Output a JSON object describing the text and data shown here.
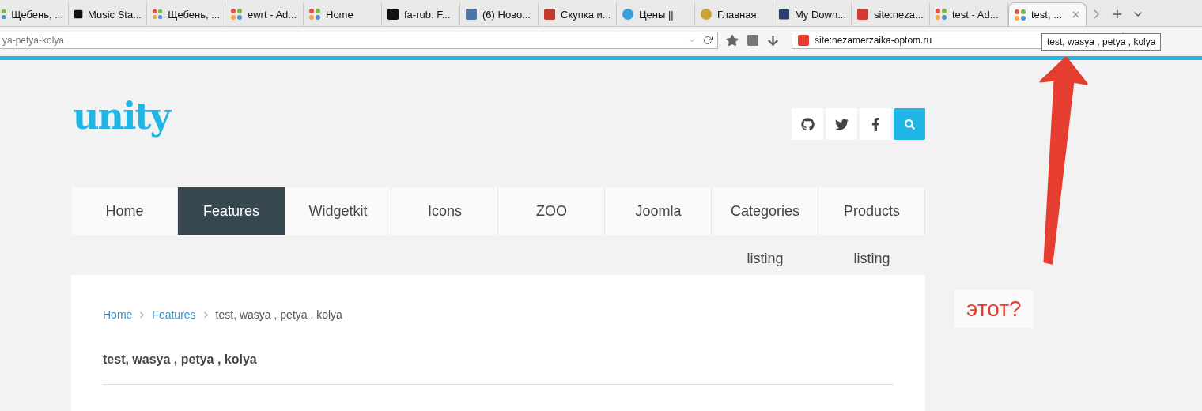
{
  "browser": {
    "tabs": [
      {
        "label": "Щебень, ...",
        "selected": false
      },
      {
        "label": "Music Sta...",
        "selected": false
      },
      {
        "label": "Щебень, ...",
        "selected": false
      },
      {
        "label": "ewrt - Ad...",
        "selected": false
      },
      {
        "label": "Home",
        "selected": false
      },
      {
        "label": "fa-rub: F...",
        "selected": false
      },
      {
        "label": "(6) Ново...",
        "selected": false
      },
      {
        "label": "Скупка и...",
        "selected": false
      },
      {
        "label": "Цены ||",
        "selected": false
      },
      {
        "label": "Главная",
        "selected": false
      },
      {
        "label": "My Down...",
        "selected": false
      },
      {
        "label": "site:neza...",
        "selected": false
      },
      {
        "label": "test - Ad...",
        "selected": false
      },
      {
        "label": "test, ...",
        "selected": true
      }
    ],
    "address_bar": {
      "value": "ya-petya-kolya"
    },
    "search_bar": {
      "value": "site:nezamerzaika-optom.ru"
    },
    "tooltip": "test, wasya , petya , kolya"
  },
  "site": {
    "logo": "unity",
    "nav": [
      {
        "label": "Home",
        "selected": false
      },
      {
        "label": "Features",
        "selected": true
      },
      {
        "label": "Widgetkit",
        "selected": false
      },
      {
        "label": "Icons",
        "selected": false
      },
      {
        "label": "ZOO",
        "selected": false
      },
      {
        "label": "Joomla",
        "selected": false
      },
      {
        "label": "Categories listing",
        "selected": false
      },
      {
        "label": "Products listing",
        "selected": false
      }
    ],
    "breadcrumb": [
      {
        "label": "Home",
        "kind": "link"
      },
      {
        "label": "Features",
        "kind": "link"
      },
      {
        "label": "test, wasya , petya , kolya",
        "kind": "current"
      }
    ],
    "title": "test, wasya , petya , kolya"
  },
  "annotation": {
    "text": "этот?"
  }
}
